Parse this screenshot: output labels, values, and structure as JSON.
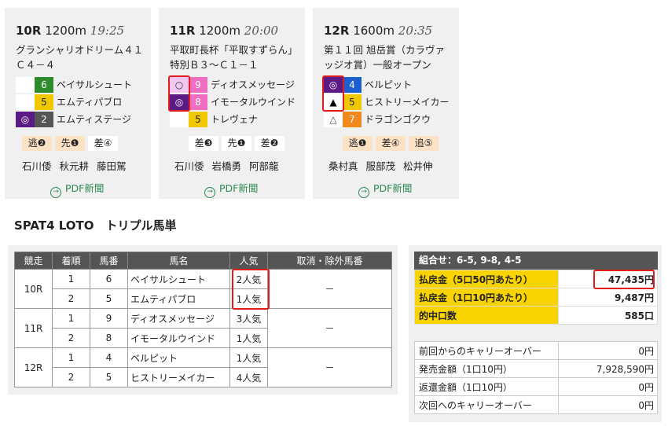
{
  "races": [
    {
      "no": "10R",
      "dist": "1200m",
      "time": "19:25",
      "name": "グランシャリオドリーム４１Ｃ４－４",
      "horses": [
        {
          "mark": "",
          "num": "6",
          "name": "ベイサルシュート",
          "color": "#2d8a2d",
          "text": "#fff"
        },
        {
          "mark": "",
          "num": "5",
          "name": "エムティパブロ",
          "color": "#f0c800",
          "text": "#222"
        },
        {
          "mark": "◎",
          "num": "2",
          "name": "エムティステージ",
          "color": "#555555",
          "text": "#fff"
        }
      ],
      "styles": [
        {
          "label": "逃",
          "n": "❷"
        },
        {
          "label": "先",
          "n": "❶"
        },
        {
          "label": "差",
          "n": "④"
        }
      ],
      "jockeys": [
        "石川倭",
        "秋元耕",
        "藤田駕"
      ],
      "pdf": "PDF新聞"
    },
    {
      "no": "11R",
      "dist": "1200m",
      "time": "20:00",
      "name": "平取町長杯「平取すずらん」特別Ｂ３～Ｃ１－１",
      "horses": [
        {
          "mark": "○",
          "num": "9",
          "name": "ディオスメッセージ",
          "color": "#f06ec0",
          "text": "#fff"
        },
        {
          "mark": "◎",
          "num": "8",
          "name": "イモータルウインド",
          "color": "#f06ec0",
          "text": "#fff"
        },
        {
          "mark": "",
          "num": "5",
          "name": "トレヴェナ",
          "color": "#f0c800",
          "text": "#222"
        }
      ],
      "styles": [
        {
          "label": "差",
          "n": "❸"
        },
        {
          "label": "先",
          "n": "❶"
        },
        {
          "label": "差",
          "n": "❷"
        }
      ],
      "jockeys": [
        "石川倭",
        "岩橋勇",
        "阿部龍"
      ],
      "pdf": "PDF新聞"
    },
    {
      "no": "12R",
      "dist": "1600m",
      "time": "20:35",
      "name": "第１１回 旭岳賞（カラヴァッジオ賞）一般オープン",
      "horses": [
        {
          "mark": "◎",
          "num": "4",
          "name": "ベルピット",
          "color": "#1e5fd0",
          "text": "#fff"
        },
        {
          "mark": "▲",
          "num": "5",
          "name": "ヒストリーメイカー",
          "color": "#f0c800",
          "text": "#222"
        },
        {
          "mark": "△",
          "num": "7",
          "name": "ドラゴンゴクウ",
          "color": "#f08a1e",
          "text": "#fff"
        }
      ],
      "styles": [
        {
          "label": "逃",
          "n": "❶"
        },
        {
          "label": "差",
          "n": "④"
        },
        {
          "label": "追",
          "n": "⑤"
        }
      ],
      "jockeys": [
        "桑村真",
        "服部茂",
        "松井伸"
      ],
      "pdf": "PDF新聞"
    }
  ],
  "section_title": "SPAT4 LOTO　トリプル馬単",
  "table": {
    "headers": [
      "競走",
      "着順",
      "馬番",
      "馬名",
      "人気",
      "取消・除外馬番"
    ],
    "rows": [
      {
        "race": "10R",
        "order": "1",
        "num": "6",
        "name": "ベイサルシュート",
        "pop": "2人気"
      },
      {
        "race": "",
        "order": "2",
        "num": "5",
        "name": "エムティパブロ",
        "pop": "1人気"
      },
      {
        "race": "11R",
        "order": "1",
        "num": "9",
        "name": "ディオスメッセージ",
        "pop": "3人気"
      },
      {
        "race": "",
        "order": "2",
        "num": "8",
        "name": "イモータルウインド",
        "pop": "1人気"
      },
      {
        "race": "12R",
        "order": "1",
        "num": "4",
        "name": "ベルピット",
        "pop": "1人気"
      },
      {
        "race": "",
        "order": "2",
        "num": "5",
        "name": "ヒストリーメイカー",
        "pop": "4人気"
      }
    ],
    "cancel": [
      "－",
      "－",
      "－"
    ]
  },
  "payout": {
    "combo": "組合せ：6-5, 9-8, 4-5",
    "rows": [
      {
        "label": "払戻金（5口50円あたり）",
        "value": "47,435円"
      },
      {
        "label": "払戻金（1口10円あたり）",
        "value": "9,487円"
      },
      {
        "label": "的中口数",
        "value": "585口"
      }
    ],
    "carry": [
      {
        "label": "前回からのキャリーオーバー",
        "value": "0円"
      },
      {
        "label": "発売金額（1口10円）",
        "value": "7,928,590円"
      },
      {
        "label": "返還金額（1口10円）",
        "value": "0円"
      },
      {
        "label": "次回へのキャリーオーバー",
        "value": "0円"
      }
    ]
  }
}
